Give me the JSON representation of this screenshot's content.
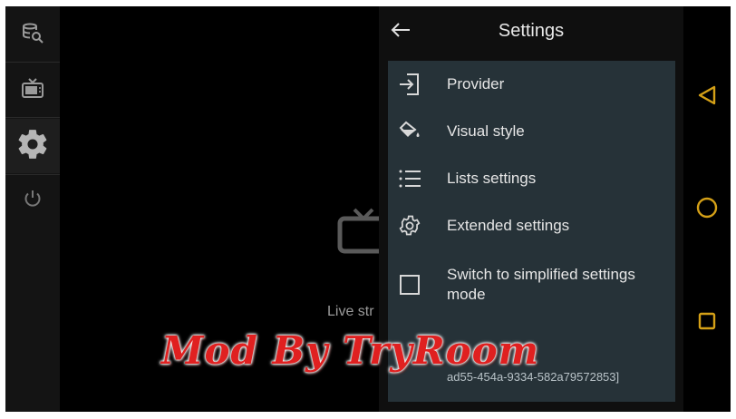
{
  "rail": {
    "items": [
      {
        "icon": "database-search-icon"
      },
      {
        "icon": "tv-icon"
      },
      {
        "icon": "gear-icon"
      },
      {
        "icon": "power-icon"
      }
    ]
  },
  "center": {
    "live_text": "Live str"
  },
  "settings": {
    "title": "Settings",
    "back_icon": "arrow-left-icon",
    "items": [
      {
        "icon": "login-icon",
        "label": "Provider"
      },
      {
        "icon": "paint-bucket-icon",
        "label": "Visual style"
      },
      {
        "icon": "list-icon",
        "label": "Lists settings"
      },
      {
        "icon": "gear-icon",
        "label": "Extended settings"
      },
      {
        "icon": "checkbox-icon",
        "label": "Switch to simplified settings mode"
      }
    ],
    "footer": "ad55-454a-9334-582a79572853]"
  },
  "navbar": {
    "accent": "#d4a017",
    "buttons": [
      "back-triangle-icon",
      "home-circle-icon",
      "recents-square-icon"
    ]
  },
  "watermark": {
    "text": "Mod By TryRoom",
    "color": "#e02020"
  }
}
